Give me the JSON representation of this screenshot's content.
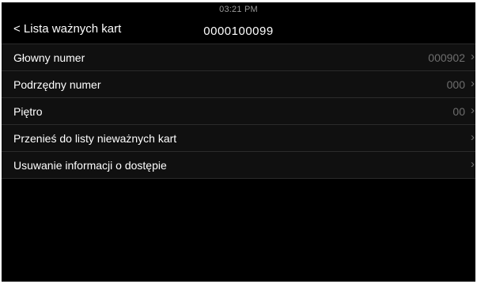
{
  "header": {
    "back_label": "< Lista ważnych kart",
    "clock": "03:21 PM",
    "card_number": "0000100099"
  },
  "rows": [
    {
      "label": "Głowny numer",
      "value": "000902",
      "icon": "chevron-right-icon"
    },
    {
      "label": "Podrzędny numer",
      "value": "000",
      "icon": "chevron-right-icon"
    },
    {
      "label": "Piętro",
      "value": "00",
      "icon": "chevron-right-icon"
    },
    {
      "label": "Przenieś do listy nieważnych kart",
      "value": "",
      "icon": "chevron-right-icon"
    },
    {
      "label": "Usuwanie informacji o dostępie",
      "value": "",
      "icon": "chevron-right-icon"
    }
  ],
  "colors": {
    "background": "#000000",
    "row_background": "#101010",
    "divider": "#2b2b2b",
    "text": "#ffffff",
    "muted_text": "#6e6e6e"
  }
}
